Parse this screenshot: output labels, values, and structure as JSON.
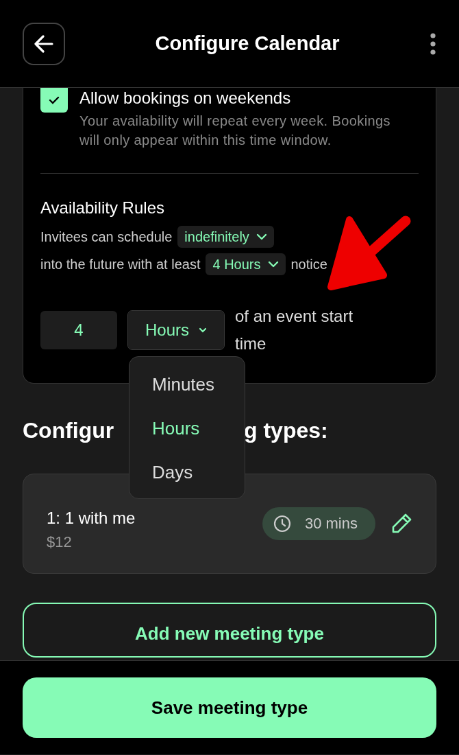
{
  "header": {
    "title": "Configure Calendar"
  },
  "weekend_option": {
    "label": "Allow bookings on weekends",
    "checked": true,
    "description": "Your availability will repeat every week. Bookings will only appear within this time window."
  },
  "availability_rules": {
    "title": "Availability Rules",
    "line_1": {
      "text": "Invitees can schedule",
      "dropdown": "indefinitely"
    },
    "line_2": {
      "before": "into the future with at least",
      "dropdown": "4 Hours",
      "after": "notice"
    },
    "notice_amount": {
      "value": "4"
    },
    "notice_unit": {
      "value": "Hours",
      "expanded": true
    },
    "suffix": "of an event start time",
    "unit_options": [
      {
        "label": "Minutes",
        "selected": false
      },
      {
        "label": "Hours",
        "selected": true
      },
      {
        "label": "Days",
        "selected": false
      }
    ]
  },
  "meeting_types": {
    "heading_parts": [
      "Configur",
      "g types:"
    ],
    "items": [
      {
        "name": "1: 1 with me",
        "price": "$12",
        "duration": "30 mins"
      }
    ],
    "add_button": "Add new meeting type"
  },
  "footer": {
    "save_button": "Save meeting type"
  }
}
